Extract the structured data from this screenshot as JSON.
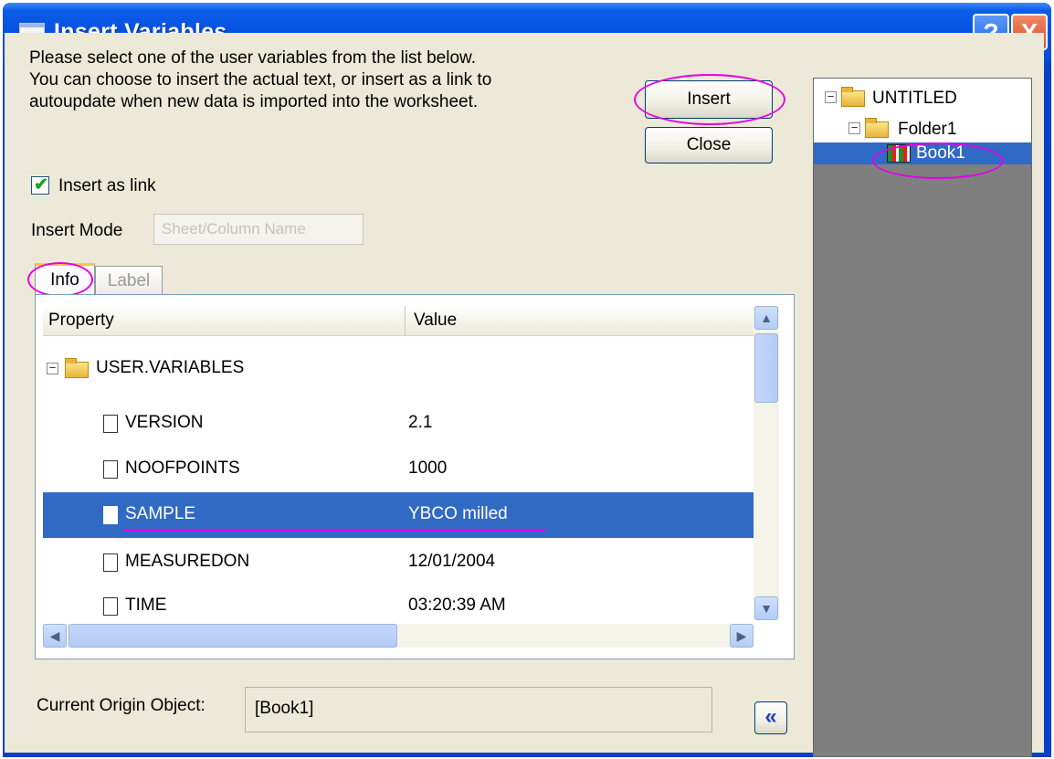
{
  "window": {
    "title": "Insert Variables",
    "help_label": "?",
    "close_label": "X"
  },
  "intro": {
    "line1": "Please select one of the user variables from the list below.",
    "line2": "You can choose to insert the actual text, or insert as a link to",
    "line3": "autoupdate when new data is imported into the worksheet."
  },
  "buttons": {
    "insert": "Insert",
    "close": "Close",
    "collapse": "«"
  },
  "insert_as_link": {
    "label": "Insert as link",
    "checked": true
  },
  "insert_mode": {
    "label": "Insert Mode",
    "value": "Sheet/Column Name"
  },
  "tabs": [
    {
      "label": "Info",
      "active": true
    },
    {
      "label": "Label",
      "active": false
    }
  ],
  "grid": {
    "columns": [
      "Property",
      "Value"
    ],
    "group": "USER.VARIABLES",
    "rows": [
      {
        "name": "VERSION",
        "value": "2.1"
      },
      {
        "name": "NOOFPOINTS",
        "value": "1000"
      },
      {
        "name": "SAMPLE",
        "value": "YBCO milled",
        "selected": true
      },
      {
        "name": "MEASUREDON",
        "value": "12/01/2004"
      },
      {
        "name": "TIME",
        "value": "03:20:39 AM"
      }
    ]
  },
  "current_object": {
    "label": "Current Origin Object:",
    "value": "[Book1]"
  },
  "tree": {
    "root": "UNTITLED",
    "folder": "Folder1",
    "book": "Book1"
  },
  "colors": {
    "title_bar": "#0a4ed8",
    "selection": "#316ac5",
    "annotation": "#e400e4",
    "dialog_bg": "#ece9d8"
  }
}
